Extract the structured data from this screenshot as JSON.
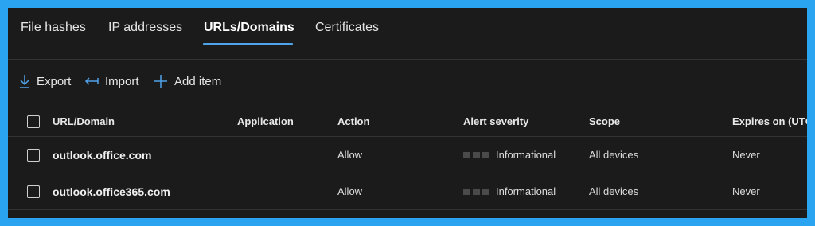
{
  "tabs": [
    {
      "label": "File hashes"
    },
    {
      "label": "IP addresses"
    },
    {
      "label": "URLs/Domains"
    },
    {
      "label": "Certificates"
    }
  ],
  "active_tab": "URLs/Domains",
  "accent_color": "#4fa3ea",
  "toolbar": {
    "export_label": "Export",
    "import_label": "Import",
    "add_label": "Add item"
  },
  "table": {
    "columns": [
      "URL/Domain",
      "Application",
      "Action",
      "Alert severity",
      "Scope",
      "Expires on (UTC)"
    ],
    "rows": [
      {
        "url": "outlook.office.com",
        "application": "",
        "action": "Allow",
        "severity": "Informational",
        "scope": "All devices",
        "expires": "Never"
      },
      {
        "url": "outlook.office365.com",
        "application": "",
        "action": "Allow",
        "severity": "Informational",
        "scope": "All devices",
        "expires": "Never"
      }
    ]
  }
}
